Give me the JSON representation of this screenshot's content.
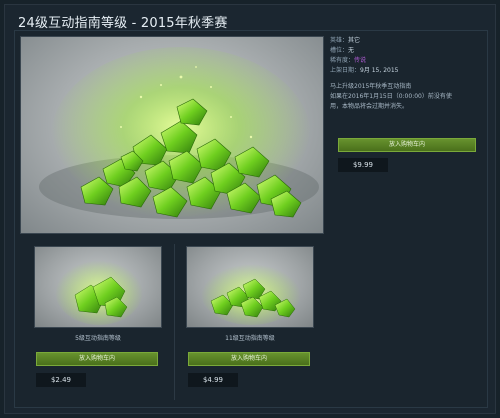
{
  "page_title": "24级互动指南等级 - 2015年秋季赛",
  "info": {
    "hero_label": "英雄：",
    "hero_value": "其它",
    "slot_label": "槽位：",
    "slot_value": "无",
    "rarity_label": "稀有度：",
    "rarity_value": "传说",
    "date_label": "上架日期：",
    "date_value": "9月 15, 2015"
  },
  "description": {
    "line1": "马上升级2015年秋季互动指南",
    "line2": "如果在2016年1月15日（0:00:00）前没有使",
    "line3": "用，本物品将会过期并消失。"
  },
  "main_item": {
    "buy_label": "放入购物车内",
    "price": "$9.99"
  },
  "items": [
    {
      "caption": "5级互动指南等级",
      "buy_label": "放入购物车内",
      "price": "$2.49"
    },
    {
      "caption": "11级互动指南等级",
      "buy_label": "放入购物车内",
      "price": "$4.99"
    }
  ],
  "colors": {
    "accent_green": "#5c8a24",
    "rarity_purple": "#b45ed9",
    "gem_green": "#7be02a"
  }
}
